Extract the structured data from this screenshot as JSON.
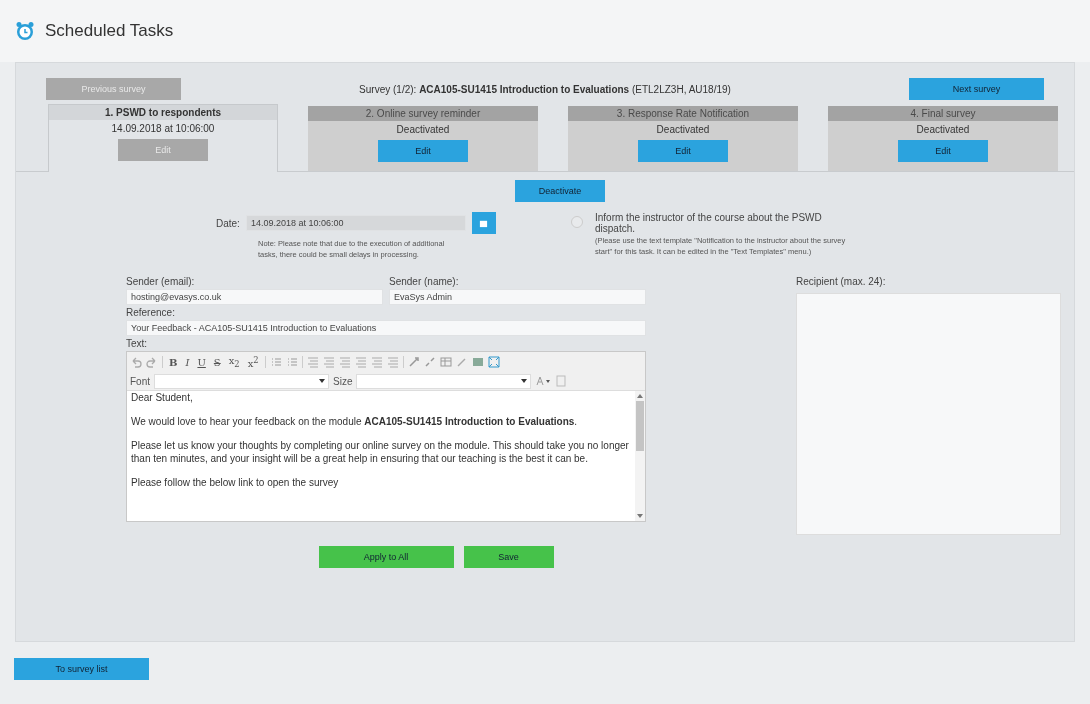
{
  "header": {
    "title": "Scheduled Tasks"
  },
  "navigation": {
    "previous": {
      "label": "Previous survey",
      "disabled": true
    },
    "survey_title": "Survey (1/2): **ACA105-SU1415 Introduction to Evaluations** (ETL2LZ3H, AU18/19)",
    "next": {
      "label": "Next survey",
      "disabled": false
    }
  },
  "tabs": [
    {
      "title": "1. PSWD to respondents",
      "status": "14.09.2018 at 10:06:00",
      "edit_label": "Edit",
      "selected": true,
      "edit_disabled": true
    },
    {
      "title": "2. Online survey reminder",
      "status": "Deactivated",
      "edit_label": "Edit",
      "selected": false,
      "edit_disabled": false
    },
    {
      "title": "3. Response Rate Notification",
      "status": "Deactivated",
      "edit_label": "Edit",
      "selected": false,
      "edit_disabled": false
    },
    {
      "title": "4. Final survey",
      "status": "Deactivated",
      "edit_label": "Edit",
      "selected": false,
      "edit_disabled": false
    }
  ],
  "deactivate_button": "Deactivate",
  "date": {
    "label": "Date:",
    "value": "14.09.2018 at 10:06:00",
    "note": "Note: Please note that due to the execution of additional tasks, there could be small delays in processing."
  },
  "inform": {
    "label": "Inform the instructor of the course about the PSWD dispatch.",
    "hint": "(Please use the text template \"Notification to the instructor about the survey start\" for this task. It can be edited in the \"Text Templates\" menu.)",
    "checked": false
  },
  "sender_email": {
    "label": "Sender (email):",
    "value": "hosting@evasys.co.uk"
  },
  "sender_name": {
    "label": "Sender (name):",
    "value": "EvaSys Admin"
  },
  "reference": {
    "label": "Reference:",
    "value": "Your Feedback - ACA105-SU1415 Introduction to Evaluations"
  },
  "text": {
    "label": "Text:",
    "format_buttons": [
      "B",
      "I",
      "U",
      "S",
      "x$_{2}$",
      "x$^{2}$"
    ],
    "font_label": "Font",
    "size_label": "Size",
    "paragraphs": [
      "Dear Student,",
      "We would love to hear your feedback on the module **ACA105-SU1415 Introduction to Evaluations**.",
      "Please let us know your thoughts by completing our online survey on the module. This should take you no longer than ten minutes, and your insight will be a great help in ensuring that our teaching is the best it can be.",
      "Please follow the below link to open the survey"
    ]
  },
  "recipient": {
    "label": "Recipient (max. 24):"
  },
  "buttons": [
    "Apply to All",
    "Save"
  ],
  "back_button": "To survey list"
}
